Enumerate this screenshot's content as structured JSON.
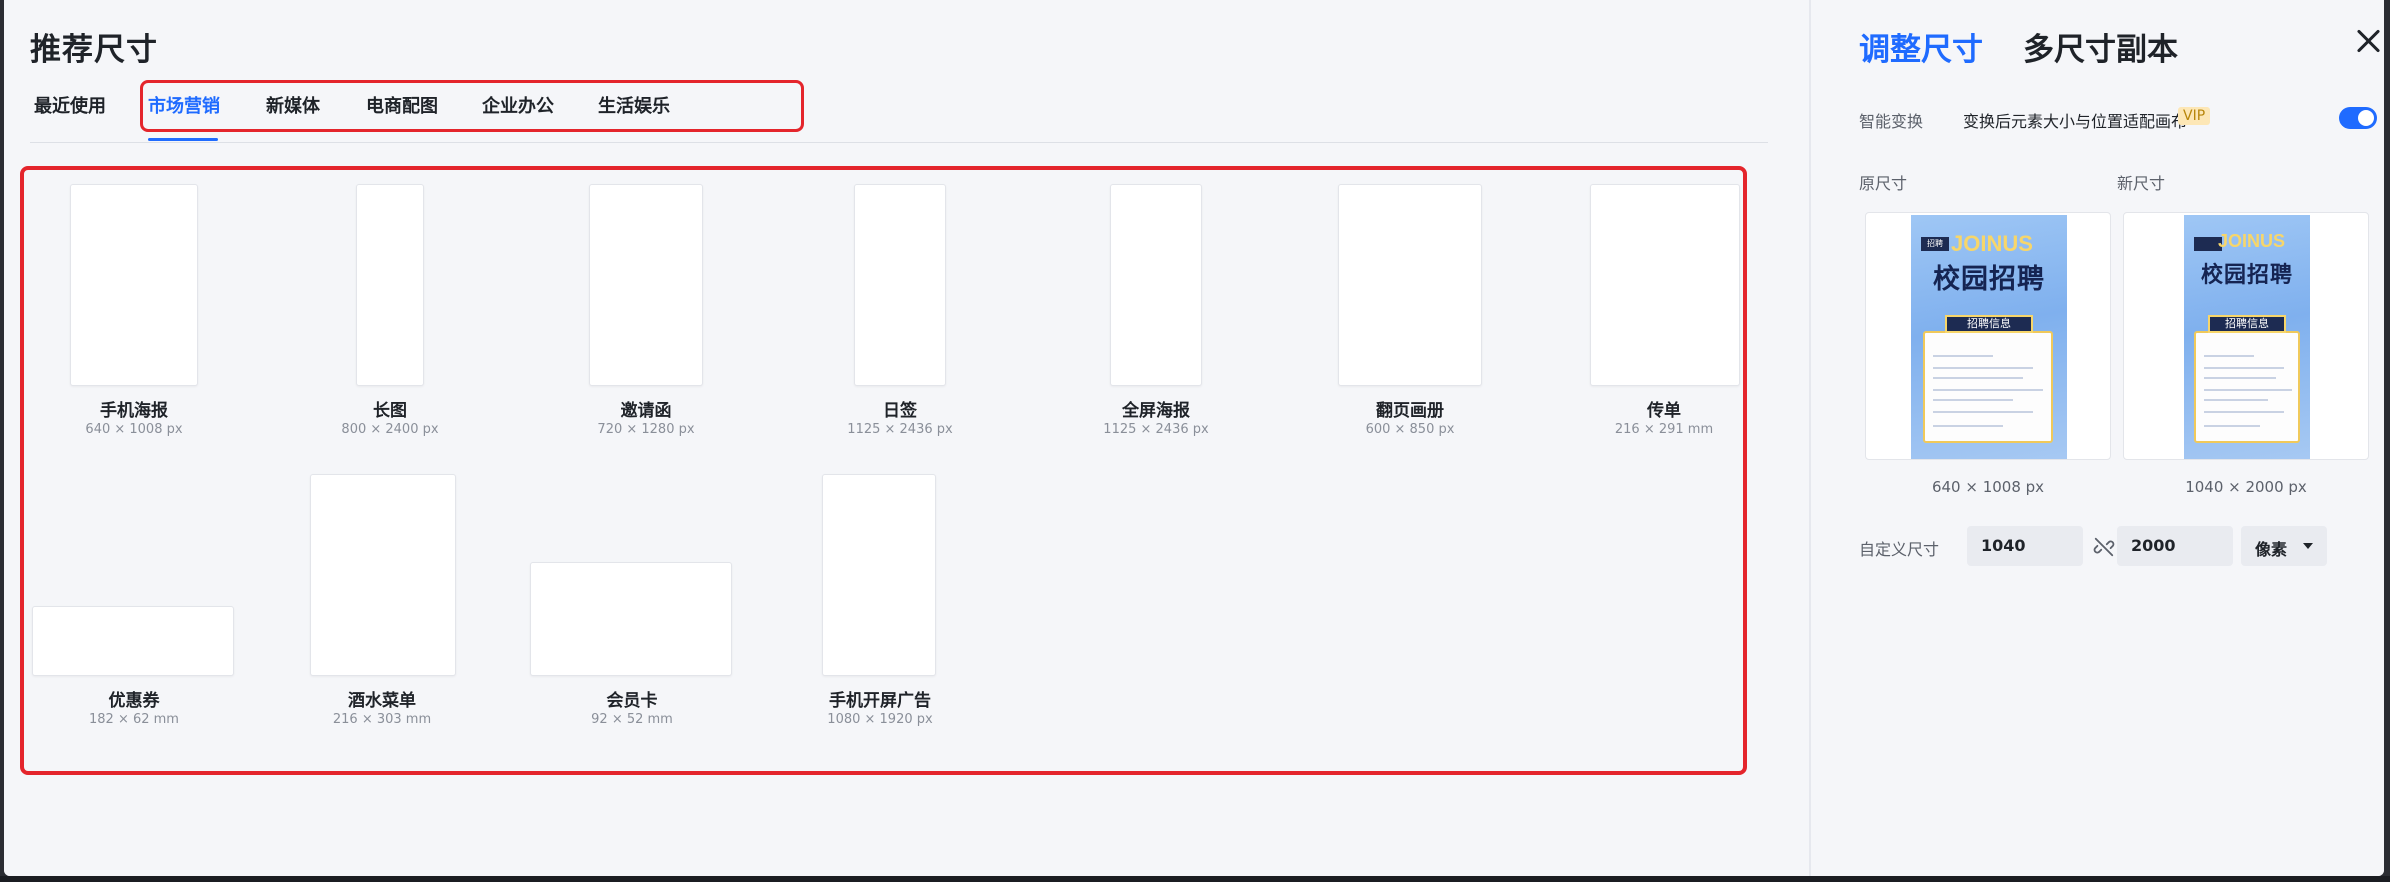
{
  "left": {
    "title": "推荐尺寸",
    "tabs": [
      "最近使用",
      "市场营销",
      "新媒体",
      "电商配图",
      "企业办公",
      "生活娱乐"
    ],
    "active_tab": "市场营销",
    "cards": [
      {
        "name": "手机海报",
        "size": "640 × 1008 px"
      },
      {
        "name": "长图",
        "size": "800 × 2400 px"
      },
      {
        "name": "邀请函",
        "size": "720 × 1280 px"
      },
      {
        "name": "日签",
        "size": "1125 × 2436 px"
      },
      {
        "name": "全屏海报",
        "size": "1125 × 2436 px"
      },
      {
        "name": "翻页画册",
        "size": "600 × 850 px"
      },
      {
        "name": "传单",
        "size": "216 × 291 mm"
      },
      {
        "name": "优惠券",
        "size": "182 × 62 mm"
      },
      {
        "name": "酒水菜单",
        "size": "216 × 303 mm"
      },
      {
        "name": "会员卡",
        "size": "92 × 52 mm"
      },
      {
        "name": "手机开屏广告",
        "size": "1080 × 1920 px"
      }
    ]
  },
  "right": {
    "tab_resize": "调整尺寸",
    "tab_copy": "多尺寸副本",
    "smart_label": "智能变换",
    "smart_desc": "变换后元素大小与位置适配画布",
    "vip": "VIP",
    "smart_enabled": true,
    "orig_label": "原尺寸",
    "new_label": "新尺寸",
    "orig_caption": "640 × 1008 px",
    "new_caption": "1040 × 2000 px",
    "poster": {
      "tag": "招聘",
      "join": "JOINUS",
      "title": "校园招聘",
      "banner": "招聘信息"
    },
    "custom_label": "自定义尺寸",
    "width_value": "1040",
    "height_value": "2000",
    "unit": "像素"
  },
  "colors": {
    "accent": "#1f6bff",
    "highlight": "#e4252c"
  }
}
